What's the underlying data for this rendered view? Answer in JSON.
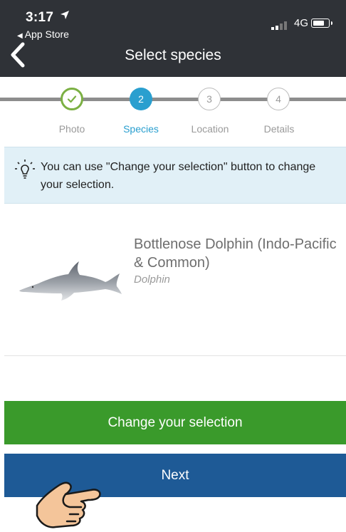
{
  "status_bar": {
    "time": "3:17",
    "back_app": "App Store",
    "network": "4G"
  },
  "header": {
    "title": "Select species"
  },
  "stepper": {
    "steps": [
      {
        "number": "",
        "label": "Photo",
        "state": "done"
      },
      {
        "number": "2",
        "label": "Species",
        "state": "active"
      },
      {
        "number": "3",
        "label": "Location",
        "state": "pending"
      },
      {
        "number": "4",
        "label": "Details",
        "state": "pending"
      }
    ]
  },
  "tip": {
    "text": "You can use \"Change your selection\" button to change your selection."
  },
  "species": {
    "name": "Bottlenose Dolphin (Indo-Pacific & Common)",
    "type": "Dolphin"
  },
  "buttons": {
    "change": "Change your selection",
    "next": "Next"
  },
  "colors": {
    "header_bg": "#2f3237",
    "active_step": "#2a9fcf",
    "done_step": "#7bb043",
    "change_button": "#3a9a2b",
    "next_button": "#1e5a96",
    "tip_bg": "#e1f0f7"
  },
  "icons": {
    "back": "chevron-left-icon",
    "tip": "lightbulb-icon",
    "done": "check-icon",
    "cursor": "pointing-hand-icon"
  }
}
